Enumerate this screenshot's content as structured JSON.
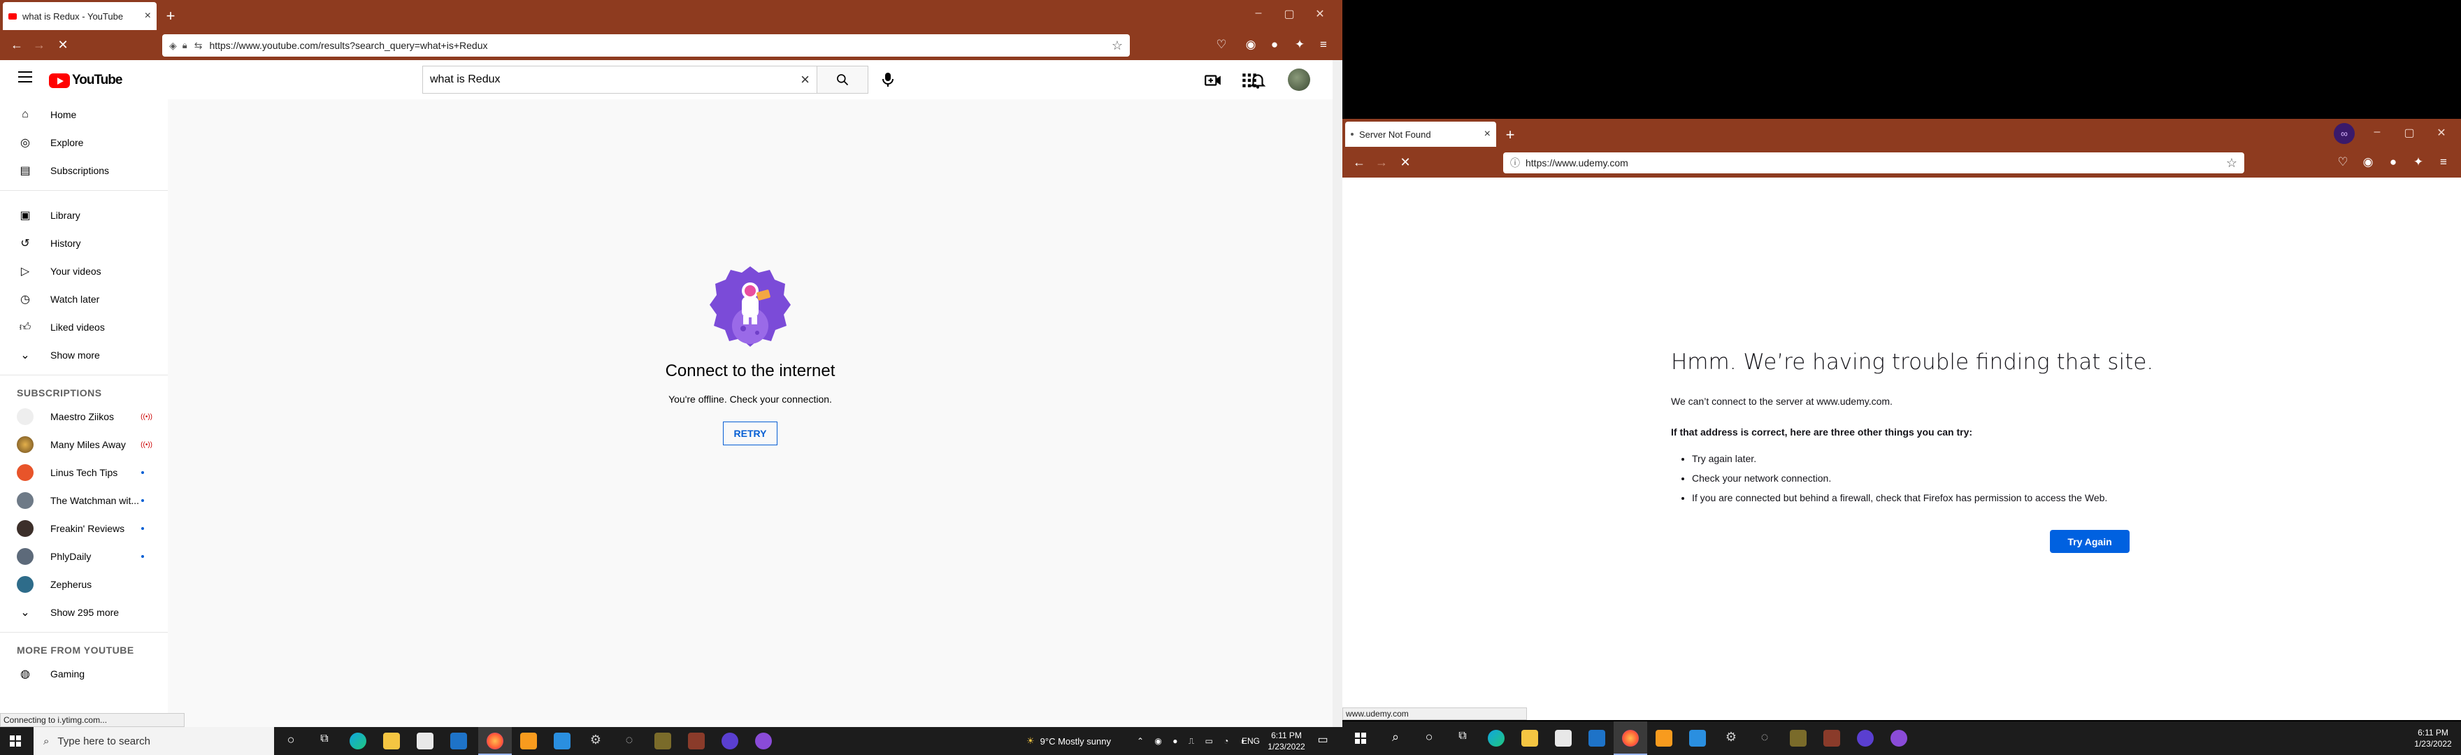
{
  "left_window": {
    "tab_title": "what is Redux - YouTube",
    "url": "https://www.youtube.com/results?search_query=what+is+Redux",
    "status_text": "Connecting to i.ytimg.com..."
  },
  "youtube": {
    "logo_text": "YouTube",
    "search_value": "what is Redux",
    "sidebar": {
      "main": [
        "Home",
        "Explore",
        "Subscriptions"
      ],
      "library": [
        "Library",
        "History",
        "Your videos",
        "Watch later",
        "Liked videos",
        "Show more"
      ],
      "subscriptions_header": "SUBSCRIPTIONS",
      "subscriptions": [
        {
          "name": "Maestro Ziikos",
          "badge": "live"
        },
        {
          "name": "Many Miles Away",
          "badge": "live"
        },
        {
          "name": "Linus Tech Tips",
          "badge": "dot"
        },
        {
          "name": "The Watchman wit...",
          "badge": "dot"
        },
        {
          "name": "Freakin' Reviews",
          "badge": "dot"
        },
        {
          "name": "PhlyDaily",
          "badge": "dot"
        },
        {
          "name": "Zepherus",
          "badge": ""
        }
      ],
      "show_more_subs": "Show 295 more",
      "more_header": "MORE FROM YOUTUBE",
      "more": [
        "Gaming"
      ]
    },
    "offline": {
      "title": "Connect to the internet",
      "message": "You're offline. Check your connection.",
      "retry": "RETRY"
    }
  },
  "right_window": {
    "tab_title": "Server Not Found",
    "url": "https://www.udemy.com",
    "status_text": "www.udemy.com",
    "error": {
      "title": "Hmm. We’re having trouble finding that site.",
      "line1": "We can’t connect to the server at www.udemy.com.",
      "line2": "If that address is correct, here are three other things you can try:",
      "tips": [
        "Try again later.",
        "Check your network connection.",
        "If you are connected but behind a firewall, check that Firefox has permission to access the Web."
      ],
      "button": "Try Again"
    }
  },
  "taskbar_left": {
    "search_placeholder": "Type here to search",
    "weather": "9°C  Mostly sunny",
    "lang": "ENG",
    "time": "6:11 PM",
    "date": "1/23/2022"
  },
  "taskbar_right": {
    "time": "6:11 PM",
    "date": "1/23/2022"
  }
}
